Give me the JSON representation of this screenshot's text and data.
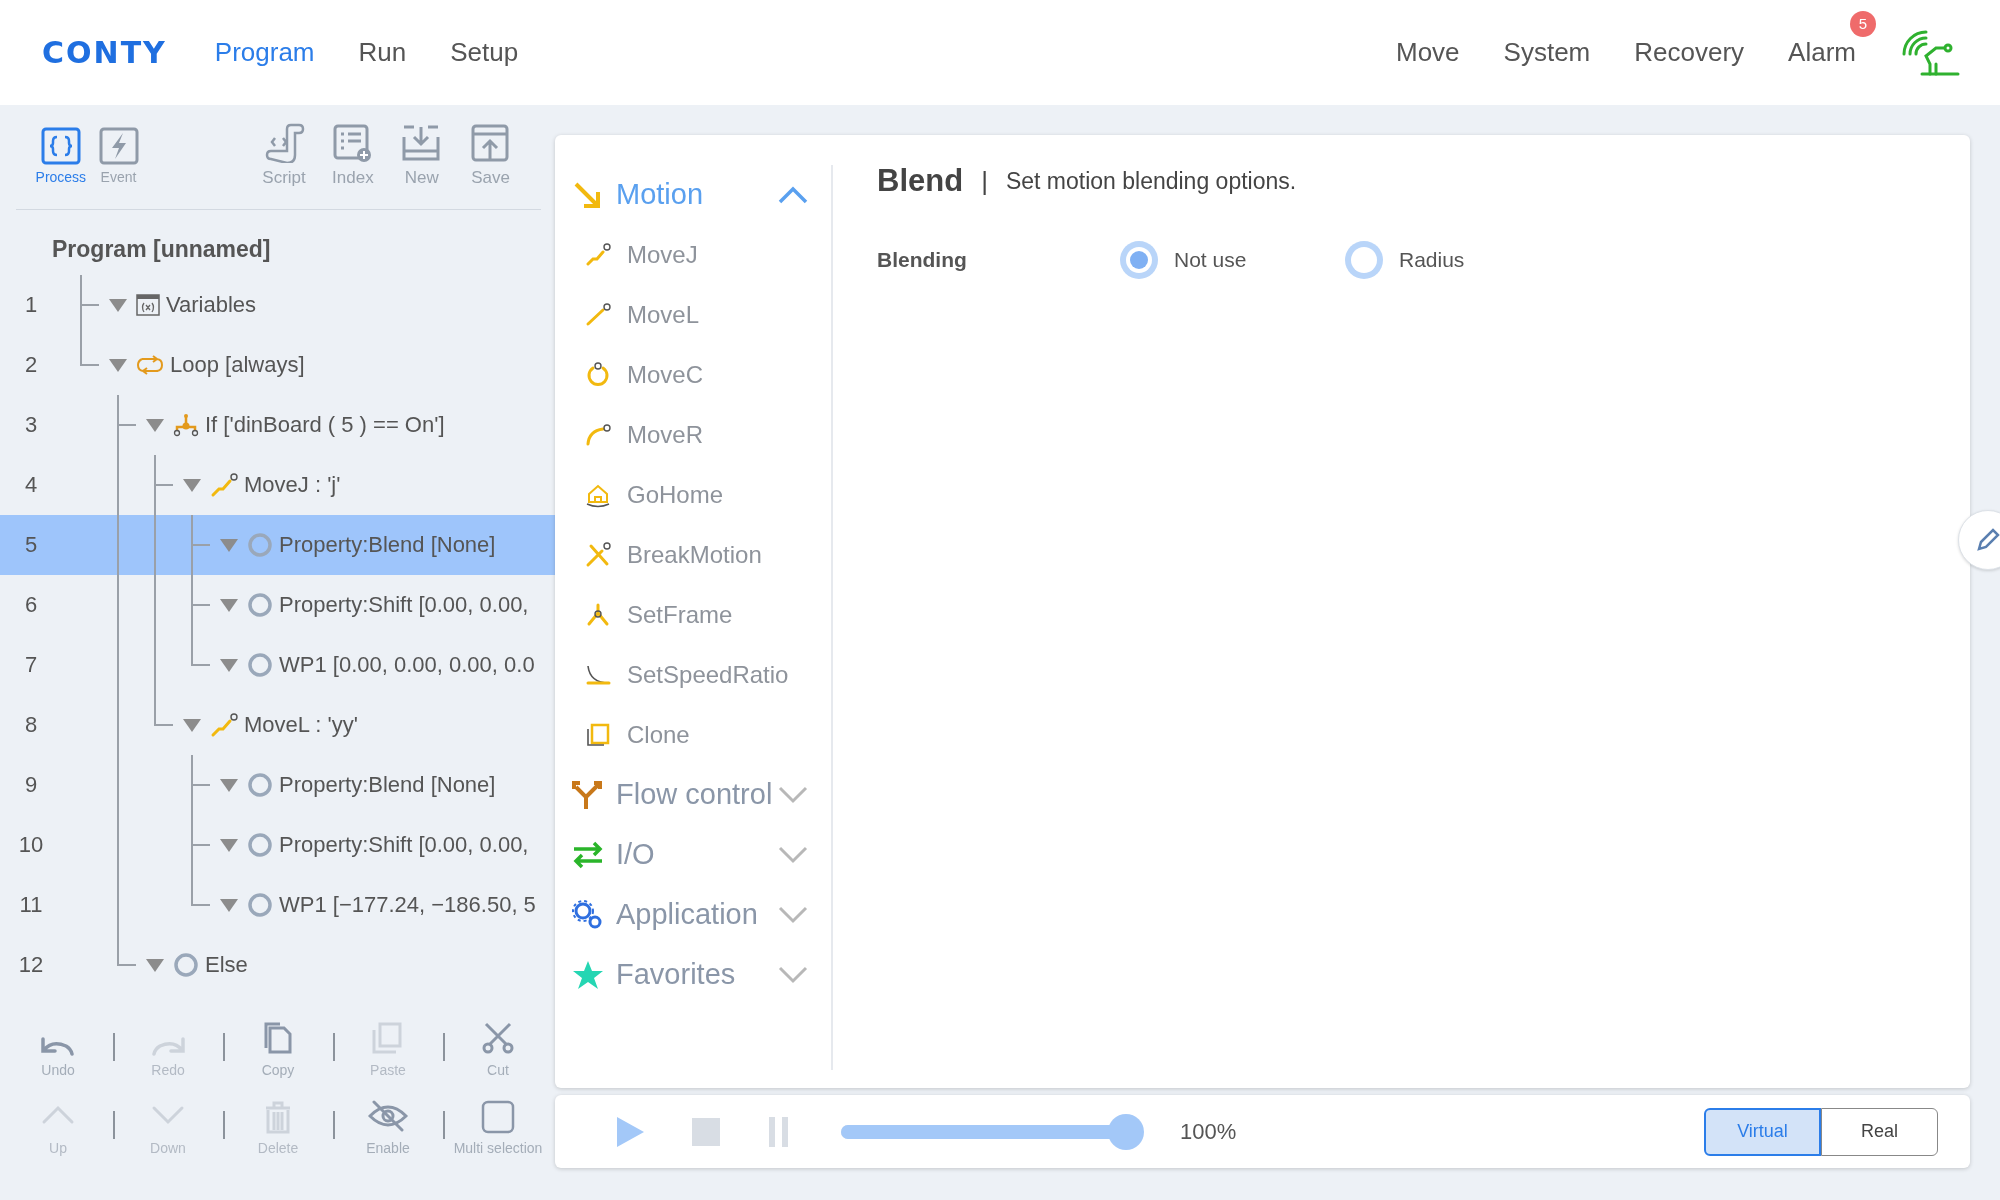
{
  "header": {
    "logo": "CONTY",
    "nav": [
      {
        "label": "Program",
        "selected": true
      },
      {
        "label": "Run",
        "selected": false
      },
      {
        "label": "Setup",
        "selected": false
      }
    ],
    "right_nav": [
      {
        "label": "Move"
      },
      {
        "label": "System"
      },
      {
        "label": "Recovery"
      },
      {
        "label": "Alarm",
        "badge": "5"
      }
    ]
  },
  "toolbar": {
    "modes": [
      {
        "label": "Process",
        "selected": true
      },
      {
        "label": "Event",
        "selected": false
      }
    ],
    "actions": [
      "Script",
      "Index",
      "New",
      "Save"
    ]
  },
  "program": {
    "title": "Program [unnamed]",
    "tree": [
      {
        "number": "1",
        "kind": "variables",
        "label": "Variables",
        "selected": false
      },
      {
        "number": "2",
        "kind": "loop",
        "label": "Loop [always]",
        "selected": false,
        "children": [
          {
            "number": "3",
            "kind": "branch",
            "label": "If ['dinBoard ( 5 )  == On']",
            "selected": false,
            "children": [
              {
                "number": "4",
                "kind": "move",
                "label": "MoveJ : 'j'",
                "selected": false,
                "children": [
                  {
                    "number": "5",
                    "kind": "node",
                    "label": "Property:Blend [None]",
                    "selected": true
                  },
                  {
                    "number": "6",
                    "kind": "node",
                    "label": "Property:Shift [0.00, 0.00,",
                    "selected": false
                  },
                  {
                    "number": "7",
                    "kind": "node",
                    "label": "WP1 [0.00, 0.00, 0.00, 0.0",
                    "selected": false
                  }
                ]
              },
              {
                "number": "8",
                "kind": "move",
                "label": "MoveL : 'yy'",
                "selected": false,
                "children": [
                  {
                    "number": "9",
                    "kind": "node",
                    "label": "Property:Blend [None]",
                    "selected": false
                  },
                  {
                    "number": "10",
                    "kind": "node",
                    "label": "Property:Shift [0.00, 0.00,",
                    "selected": false
                  },
                  {
                    "number": "11",
                    "kind": "node",
                    "label": "WP1 [−177.24, −186.50, 5",
                    "selected": false
                  }
                ]
              }
            ]
          },
          {
            "number": "12",
            "kind": "node",
            "label": "Else",
            "selected": false
          }
        ]
      }
    ]
  },
  "edit_tools": [
    {
      "label": "Undo",
      "disabled": false
    },
    {
      "label": "Redo",
      "disabled": true
    },
    {
      "label": "Copy",
      "disabled": false
    },
    {
      "label": "Paste",
      "disabled": true
    },
    {
      "label": "Cut",
      "disabled": false
    },
    {
      "label": "Up",
      "disabled": true
    },
    {
      "label": "Down",
      "disabled": true
    },
    {
      "label": "Delete",
      "disabled": true
    },
    {
      "label": "Enable",
      "disabled": false
    },
    {
      "label": "Multi selection",
      "disabled": false
    }
  ],
  "command_menu": [
    {
      "kind": "motion",
      "label": "Motion",
      "expanded": true,
      "items": [
        {
          "kind": "movej",
          "label": "MoveJ"
        },
        {
          "kind": "movel",
          "label": "MoveL"
        },
        {
          "kind": "movec",
          "label": "MoveC"
        },
        {
          "kind": "mover",
          "label": "MoveR"
        },
        {
          "kind": "home",
          "label": "GoHome"
        },
        {
          "kind": "break",
          "label": "BreakMotion"
        },
        {
          "kind": "frame",
          "label": "SetFrame"
        },
        {
          "kind": "speed",
          "label": "SetSpeedRatio"
        },
        {
          "kind": "clone",
          "label": "Clone"
        }
      ]
    },
    {
      "kind": "flow",
      "label": "Flow control",
      "expanded": false
    },
    {
      "kind": "io",
      "label": "I/O",
      "expanded": false
    },
    {
      "kind": "application",
      "label": "Application",
      "expanded": false
    },
    {
      "kind": "favorites",
      "label": "Favorites",
      "expanded": false
    }
  ],
  "property_panel": {
    "title": "Blend",
    "separator": "|",
    "description": "Set motion blending options.",
    "field": "Blending",
    "options": [
      {
        "label": "Not use",
        "selected": true
      },
      {
        "label": "Radius",
        "selected": false
      }
    ]
  },
  "run_bar": {
    "speed": {
      "level": 1.0,
      "reading": "100%"
    },
    "modes": [
      {
        "label": "Virtual",
        "selected": true
      },
      {
        "label": "Real",
        "selected": false
      }
    ]
  }
}
